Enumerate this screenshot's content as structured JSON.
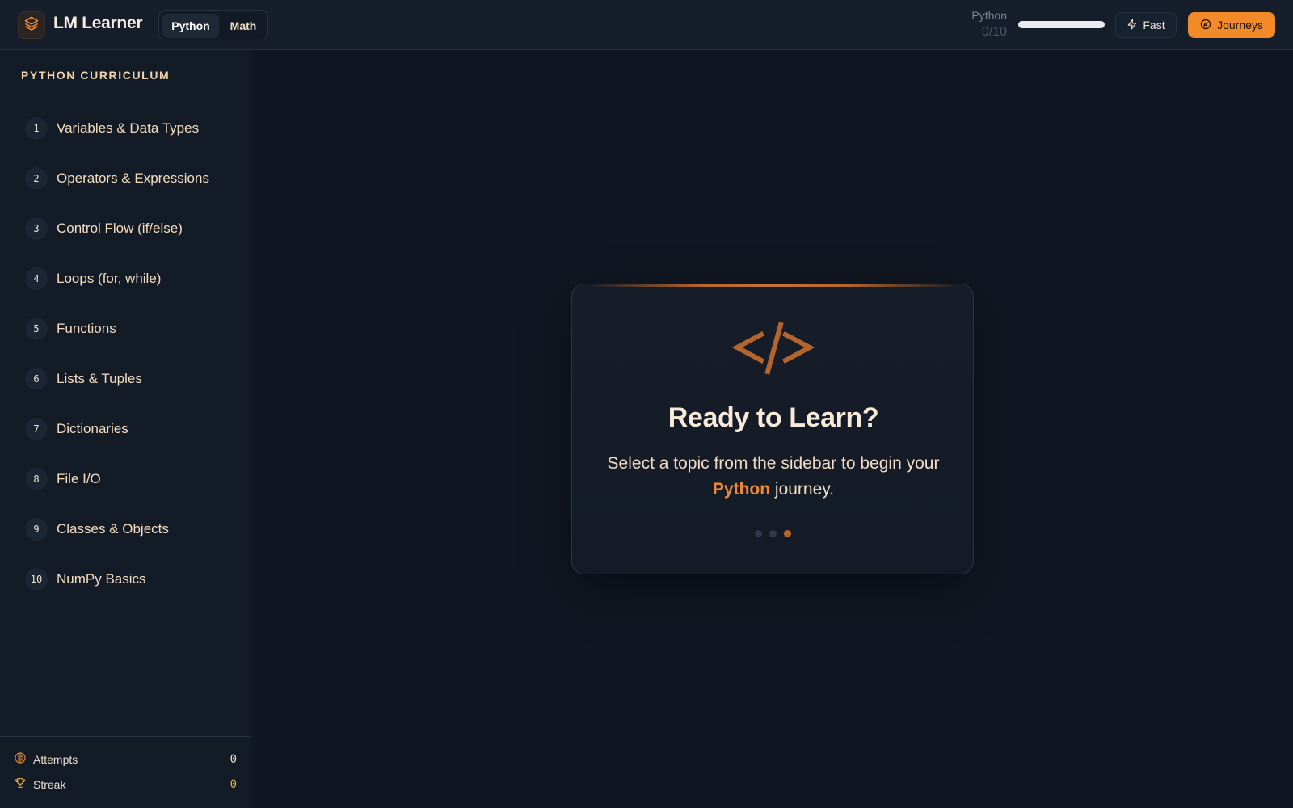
{
  "header": {
    "app_title": "LM Learner",
    "tabs": [
      {
        "label": "Python",
        "active": true
      },
      {
        "label": "Math",
        "active": false
      }
    ],
    "progress": {
      "label": "Python",
      "count_text": "0/10",
      "fraction": 0
    },
    "fast_label": "Fast",
    "journeys_label": "Journeys"
  },
  "sidebar": {
    "title": "PYTHON CURRICULUM",
    "topics": [
      {
        "num": "1",
        "label": "Variables & Data Types"
      },
      {
        "num": "2",
        "label": "Operators & Expressions"
      },
      {
        "num": "3",
        "label": "Control Flow (if/else)"
      },
      {
        "num": "4",
        "label": "Loops (for, while)"
      },
      {
        "num": "5",
        "label": "Functions"
      },
      {
        "num": "6",
        "label": "Lists & Tuples"
      },
      {
        "num": "7",
        "label": "Dictionaries"
      },
      {
        "num": "8",
        "label": "File I/O"
      },
      {
        "num": "9",
        "label": "Classes & Objects"
      },
      {
        "num": "10",
        "label": "NumPy Basics"
      }
    ],
    "stats": {
      "attempts_label": "Attempts",
      "attempts_value": "0",
      "streak_label": "Streak",
      "streak_value": "0"
    }
  },
  "main": {
    "card": {
      "icon": "code-brackets-icon",
      "title": "Ready to Learn?",
      "text_before": "Select a topic from the sidebar to begin your ",
      "text_highlight": "Python",
      "text_after": " journey."
    }
  },
  "colors": {
    "accent": "#f38a2a",
    "background": "#111722",
    "panel": "#161e2b",
    "dot_inactive": "#2e394b",
    "dot_active": "#b4652d",
    "streak_value": "#e6b04a"
  }
}
